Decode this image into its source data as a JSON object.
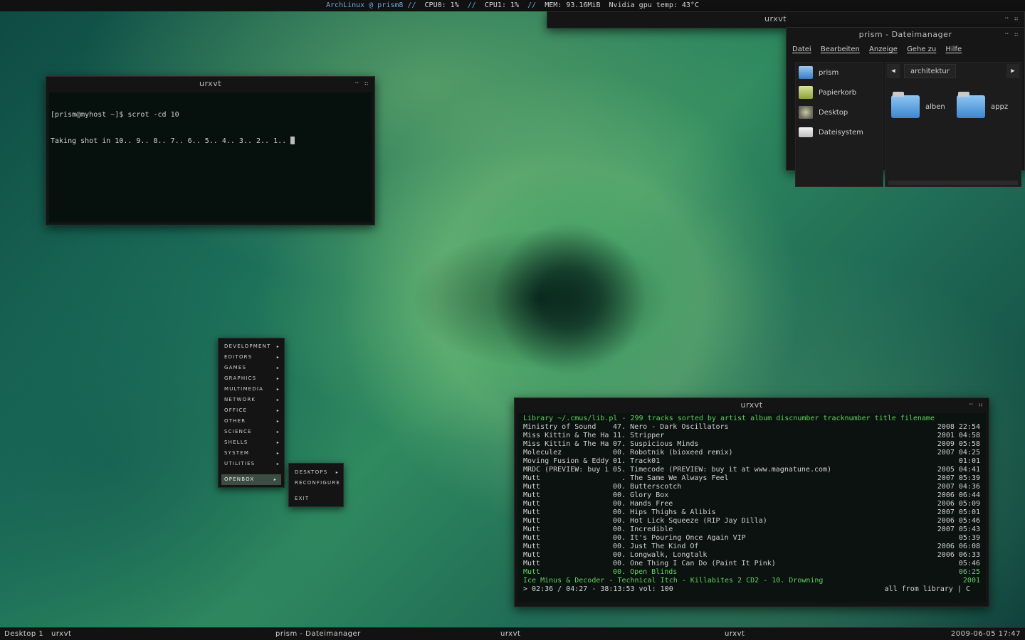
{
  "topbar": {
    "os": "ArchLinux",
    "user": "@ prism8",
    "sep": "//",
    "cpu0_label": "CPU0:",
    "cpu0_value": "1%",
    "cpu1_label": "CPU1:",
    "cpu1_value": "1%",
    "mem_label": "MEM:",
    "mem_value": "93.16MiB",
    "gpu_label": "Nvidia gpu temp:",
    "gpu_value": "43°C"
  },
  "urxvt_top": {
    "title": "urxvt",
    "buttons": "⠒ ⠶"
  },
  "terminal": {
    "title": "urxvt",
    "buttons": "⠒ ⠶",
    "lines": [
      "[prism@myhost ~]$ scrot -cd 10",
      "Taking shot in 10.. 9.. 8.. 7.. 6.. 5.. 4.. 3.. 2.. 1.. "
    ]
  },
  "filemanager": {
    "title": "prism - Dateimanager",
    "buttons": "⠒ ⠶",
    "menu": [
      "Datei",
      "Bearbeiten",
      "Anzeige",
      "Gehe zu",
      "Hilfe"
    ],
    "places": [
      {
        "label": "prism",
        "icon": "home-folder-icon"
      },
      {
        "label": "Papierkorb",
        "icon": "trash-icon"
      },
      {
        "label": "Desktop",
        "icon": "desktop-icon"
      },
      {
        "label": "Dateisystem",
        "icon": "drive-icon"
      }
    ],
    "back": "◀",
    "forward": "▶",
    "crumb": "architektur",
    "folders": [
      "alben",
      "appz"
    ]
  },
  "openbox_menu": {
    "items": [
      "DEVELOPMENT",
      "EDITORS",
      "GAMES",
      "GRAPHICS",
      "MULTIMEDIA",
      "NETWORK",
      "OFFICE",
      "OTHER",
      "SCIENCE",
      "SHELLS",
      "SYSTEM",
      "UTILITIES"
    ],
    "active": "OPENBOX",
    "submenu": [
      "DESKTOPS",
      "RECONFIGURE",
      "EXIT"
    ],
    "arrow": "▸"
  },
  "cmus": {
    "title": "urxvt",
    "buttons": "⠒ ⠶",
    "header": "Library ~/.cmus/lib.pl - 299 tracks sorted by artist album discnumber tracknumber title filename",
    "rows": [
      {
        "artist": "Ministry of Sound",
        "track": "47. Nero - Dark Oscillators",
        "date": "2008 22:54"
      },
      {
        "artist": "Miss Kittin & The Ha",
        "track": "11. Stripper",
        "date": "2001 04:58"
      },
      {
        "artist": "Miss Kittin & The Ha",
        "track": "07. Suspicious Minds",
        "date": "2009 05:58"
      },
      {
        "artist": "Moleculez",
        "track": "00. Robotnik (bioxeed remix)",
        "date": "2007 04:25"
      },
      {
        "artist": "Moving Fusion & Eddy",
        "track": "01. Track01",
        "date": "01:01"
      },
      {
        "artist": "MRDC (PREVIEW: buy i",
        "track": "05. Timecode (PREVIEW: buy it at www.magnatune.com)",
        "date": "2005 04:41"
      },
      {
        "artist": "Mutt",
        "track": "  . The Same We Always Feel",
        "date": "2007 05:39"
      },
      {
        "artist": "Mutt",
        "track": "00. Butterscotch",
        "date": "2007 04:36"
      },
      {
        "artist": "Mutt",
        "track": "00. Glory Box",
        "date": "2006 06:44"
      },
      {
        "artist": "Mutt",
        "track": "00. Hands Free",
        "date": "2006 05:09"
      },
      {
        "artist": "Mutt",
        "track": "00. Hips Thighs & Alibis",
        "date": "2007 05:01"
      },
      {
        "artist": "Mutt",
        "track": "00. Hot Lick Squeeze (RIP Jay Dilla)",
        "date": "2006 05:46"
      },
      {
        "artist": "Mutt",
        "track": "00. Incredible",
        "date": "2007 05:43"
      },
      {
        "artist": "Mutt",
        "track": "00. It's Pouring Once Again VIP",
        "date": "05:39"
      },
      {
        "artist": "Mutt",
        "track": "00. Just The Kind Of",
        "date": "2006 06:08"
      },
      {
        "artist": "Mutt",
        "track": "00. Longwalk, Longtalk",
        "date": "2006 06:33"
      },
      {
        "artist": "Mutt",
        "track": "00. One Thing I Can Do (Paint It Pink)",
        "date": "05:46"
      },
      {
        "artist": "Mutt",
        "track": "00. Open Blinds",
        "date": "06:25",
        "playing": true
      }
    ],
    "nowplaying": "Ice Minus & Decoder - Technical Itch - Killabites 2 CD2 - 10. Drowning",
    "nowplaying_year": "2001",
    "status_left": "> 02:36 / 04:27 - 38:13:53 vol: 100",
    "status_right": "all from library | C"
  },
  "bottombar": {
    "desktop": "Desktop 1",
    "tasks": [
      "urxvt",
      "prism - Dateimanager",
      "urxvt",
      "urxvt"
    ],
    "datetime": "2009-06-05 17:47"
  }
}
